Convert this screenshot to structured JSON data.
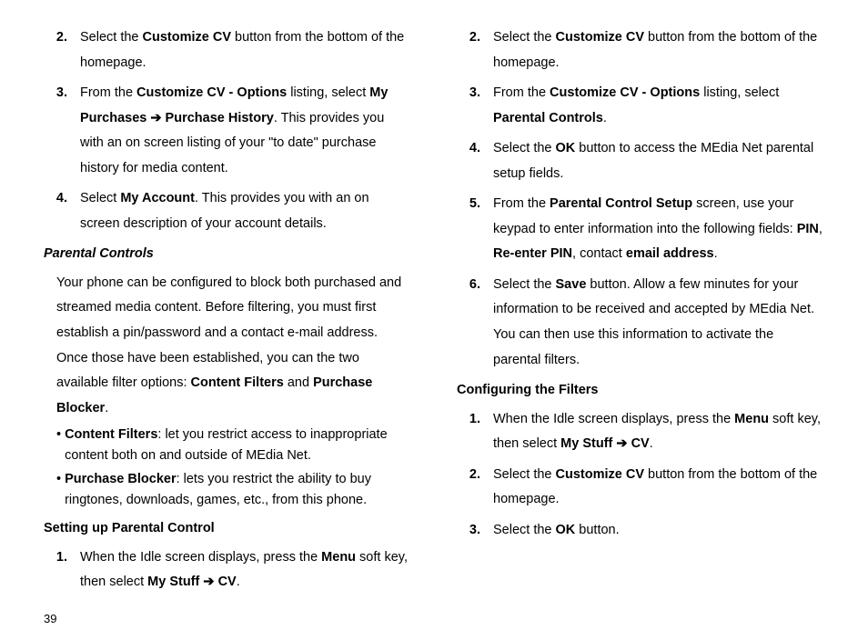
{
  "page_number": "39",
  "left": {
    "list_a": [
      {
        "num": "2.",
        "parts": [
          "Select the ",
          "Customize CV",
          " button from the bottom of the homepage."
        ]
      },
      {
        "num": "3.",
        "parts": [
          "From the ",
          "Customize CV - Options",
          " listing, select ",
          "My Purchases ➔ Purchase History",
          ". This provides you with an on screen listing of your \"to date\" purchase history for media content."
        ]
      },
      {
        "num": "4.",
        "parts": [
          "Select ",
          "My Account",
          ". This provides you with an on screen description of your account details."
        ]
      }
    ],
    "heading_a": "Parental Controls",
    "para_a_parts": [
      "Your phone can be configured to block both purchased and streamed media content. Before filtering, you must first establish a pin/password and a contact e-mail address. Once those have been established, you can the two available filter options: ",
      "Content Filters",
      " and ",
      "Purchase Blocker",
      "."
    ],
    "bullets": [
      {
        "bold": "Content Filters",
        "rest": ": let you restrict access to inappropriate content both on and outside of MEdia Net."
      },
      {
        "bold": "Purchase Blocker",
        "rest": ": lets you restrict the ability to buy ringtones, downloads, games, etc., from this phone."
      }
    ],
    "heading_b": "Setting up Parental Control",
    "list_b": [
      {
        "num": "1.",
        "parts": [
          "When the Idle screen displays, press the ",
          "Menu",
          " soft key, then select ",
          "My Stuff ➔ CV",
          "."
        ]
      }
    ]
  },
  "right": {
    "list_a": [
      {
        "num": "2.",
        "parts": [
          "Select the ",
          "Customize CV",
          " button from the bottom of the homepage."
        ]
      },
      {
        "num": "3.",
        "parts": [
          "From the ",
          "Customize CV - Options",
          " listing, select ",
          "Parental Controls",
          "."
        ]
      },
      {
        "num": "4.",
        "parts": [
          "Select the ",
          "OK",
          " button to access the MEdia Net parental setup fields."
        ]
      },
      {
        "num": "5.",
        "parts": [
          "From the ",
          "Parental Control Setup",
          " screen, use your keypad to enter information into the following fields: ",
          "PIN",
          ", ",
          "Re-enter PIN",
          ", contact ",
          "email address",
          "."
        ]
      },
      {
        "num": "6.",
        "parts": [
          "Select the ",
          "Save",
          " button. Allow a few minutes for your information to be received and accepted by MEdia Net. You can then use this information to activate the parental filters."
        ]
      }
    ],
    "heading_a": "Configuring the Filters",
    "list_b": [
      {
        "num": "1.",
        "parts": [
          "When the Idle screen displays, press the ",
          "Menu",
          " soft key, then select ",
          "My Stuff ➔ CV",
          "."
        ]
      },
      {
        "num": "2.",
        "parts": [
          "Select the ",
          "Customize CV",
          " button from the bottom of the homepage."
        ]
      },
      {
        "num": "3.",
        "parts": [
          "Select the ",
          "OK",
          " button."
        ]
      }
    ]
  }
}
